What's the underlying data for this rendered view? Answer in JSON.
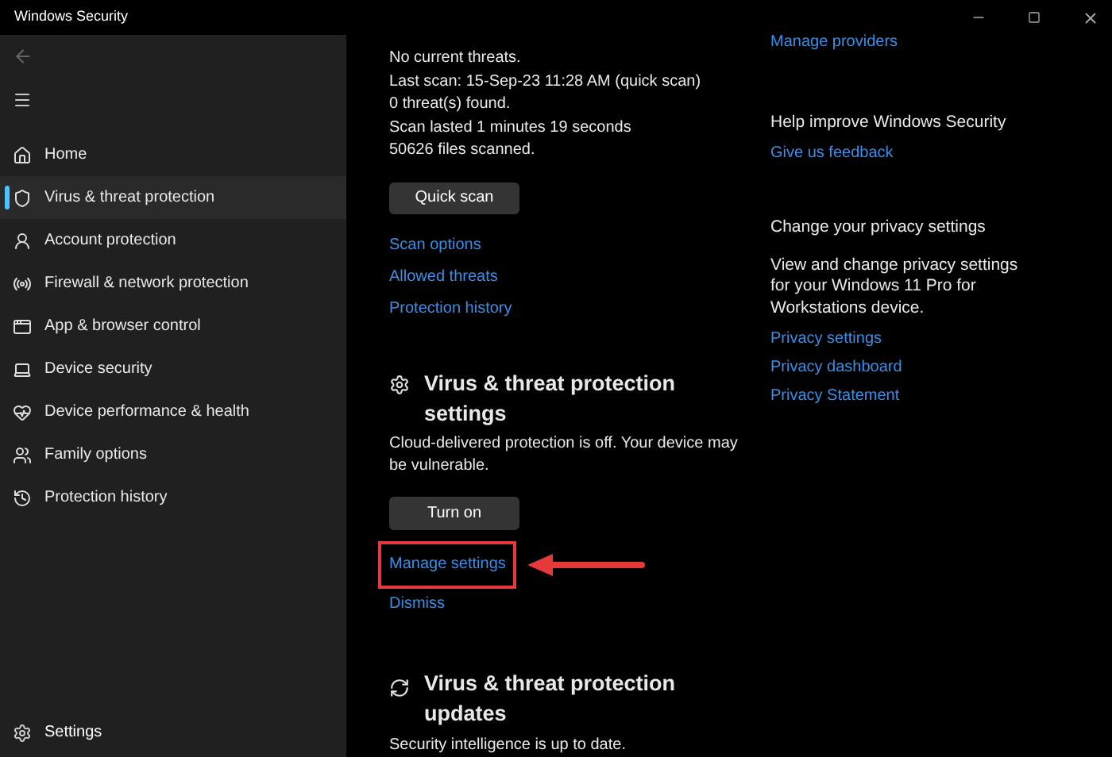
{
  "window": {
    "title": "Windows Security"
  },
  "sidebar": {
    "items": [
      {
        "label": "Home",
        "selected": false
      },
      {
        "label": "Virus & threat protection",
        "selected": true
      },
      {
        "label": "Account protection",
        "selected": false
      },
      {
        "label": "Firewall & network protection",
        "selected": false
      },
      {
        "label": "App & browser control",
        "selected": false
      },
      {
        "label": "Device security",
        "selected": false
      },
      {
        "label": "Device performance & health",
        "selected": false
      },
      {
        "label": "Family options",
        "selected": false
      },
      {
        "label": "Protection history",
        "selected": false
      }
    ],
    "settings": "Settings"
  },
  "threats": {
    "lines": [
      "No current threats.",
      "Last scan: 15-Sep-23 11:28 AM (quick scan)",
      "0 threat(s) found.",
      "Scan lasted 1 minutes 19 seconds",
      "50626 files scanned."
    ],
    "button": "Quick scan",
    "links": [
      {
        "label": "Scan options",
        "highlighted": false
      },
      {
        "label": "Allowed threats",
        "highlighted": false
      },
      {
        "label": "Protection history",
        "highlighted": false
      }
    ]
  },
  "protection_settings": {
    "title": "Virus & threat protection settings",
    "description": "Cloud-delivered protection is off. Your device may be vulnerable.",
    "button": "Turn on",
    "links": [
      {
        "label": "Manage settings",
        "highlighted": true
      },
      {
        "label": "Dismiss",
        "highlighted": false
      }
    ]
  },
  "updates": {
    "title": "Virus & threat protection updates",
    "description": "Security intelligence is up to date."
  },
  "right": {
    "top_link": "Manage providers",
    "feedback": {
      "title": "Help improve Windows Security",
      "link": "Give us feedback"
    },
    "privacy": {
      "title": "Change your privacy settings",
      "description": "View and change privacy settings for your Windows 11 Pro for Workstations device.",
      "links": [
        "Privacy settings",
        "Privacy dashboard",
        "Privacy Statement"
      ]
    }
  }
}
